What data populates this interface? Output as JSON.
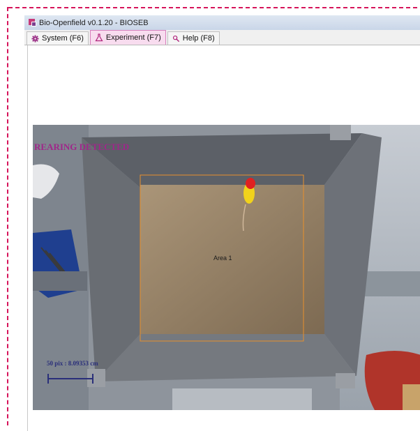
{
  "window": {
    "title": "Bio-Openfield v0.1.20 - BIOSEB"
  },
  "tabs": [
    {
      "label": "System (F6)",
      "icon": "gear-icon",
      "active": false
    },
    {
      "label": "Experiment (F7)",
      "icon": "flask-icon",
      "active": true
    },
    {
      "label": "Help (F8)",
      "icon": "help-icon",
      "active": false
    }
  ],
  "video": {
    "status_text": "REARING DETECTED",
    "area_label": "Area 1",
    "scale_label": "50 pix : 8.09353 cm"
  },
  "colors": {
    "status_text": "#a0268a",
    "area_outline": "#e8902c",
    "scale_bar": "#2a2f7a",
    "active_tab": "#f8dcef"
  }
}
